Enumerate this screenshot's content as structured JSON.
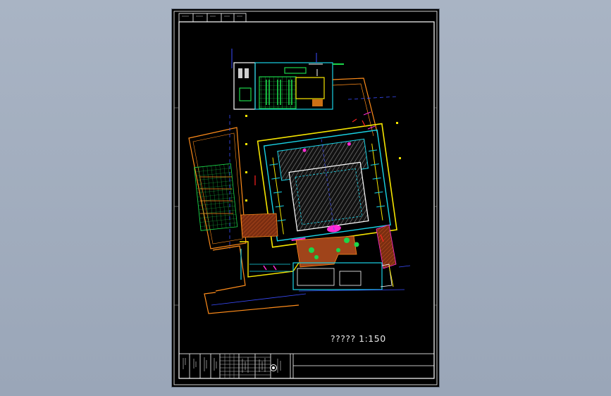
{
  "app": {
    "viewport_background": "#a3aebf",
    "sheet_background": "#000000"
  },
  "drawing": {
    "scale_label": "????? 1:150"
  },
  "title_block": {
    "seal_icon": "round-seal-icon"
  },
  "colors": {
    "frame": "#ffffff",
    "wall_cyan": "#19d3e6",
    "wall_yellow": "#f5e400",
    "orange": "#ff8c1a",
    "green": "#1bd64a",
    "magenta": "#ff2bd6",
    "blue": "#3a4cff",
    "hatch_brown": "#a0441a",
    "red": "#ff2020"
  },
  "icons": [
    "floor-plan-drawing",
    "tree-symbol-icon",
    "round-seal-icon"
  ]
}
